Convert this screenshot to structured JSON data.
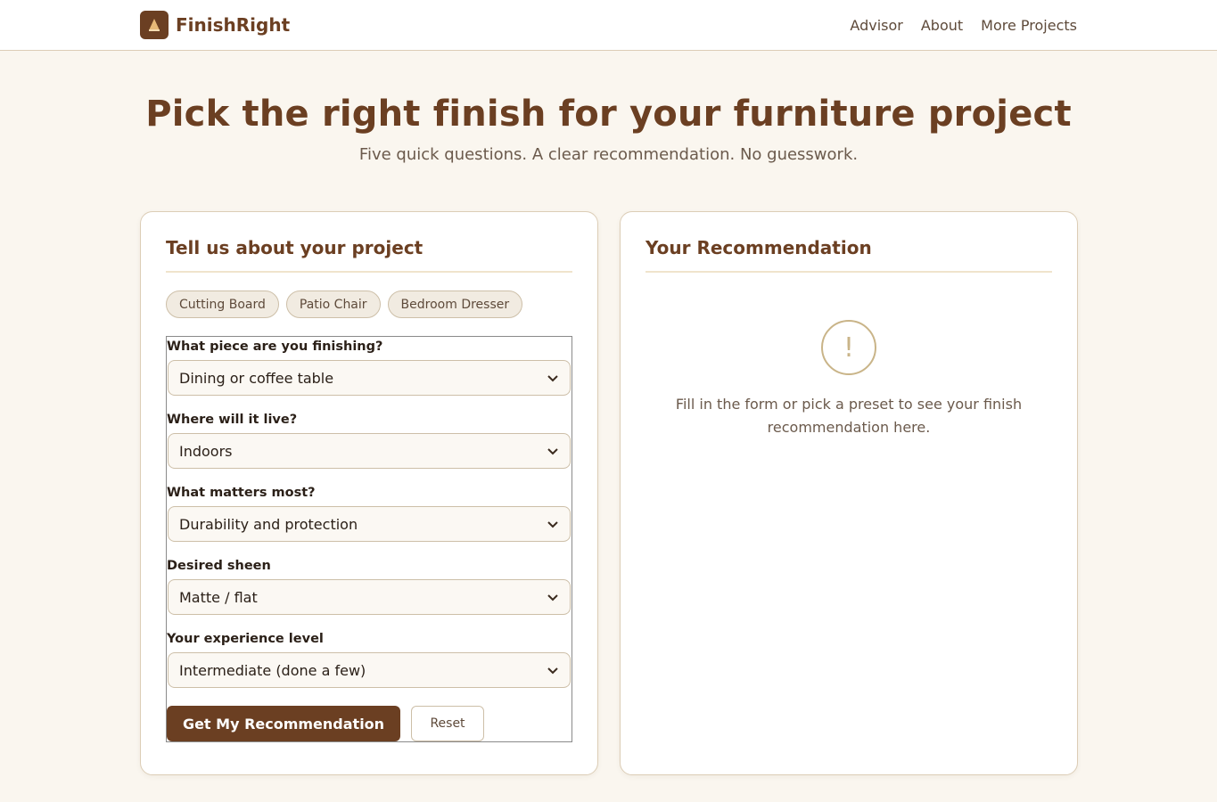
{
  "brand": {
    "name": "FinishRight",
    "logo_icon": "cone-logo-icon"
  },
  "nav": {
    "items": [
      "Advisor",
      "About",
      "More Projects"
    ]
  },
  "hero": {
    "title": "Pick the right finish for your furniture project",
    "subtitle": "Five quick questions. A clear recommendation. No guesswork."
  },
  "form_card": {
    "title": "Tell us about your project",
    "presets": [
      "Cutting Board",
      "Patio Chair",
      "Bedroom Dresser"
    ],
    "fields": [
      {
        "label": "What piece are you finishing?",
        "value": "Dining or coffee table"
      },
      {
        "label": "Where will it live?",
        "value": "Indoors"
      },
      {
        "label": "What matters most?",
        "value": "Durability and protection"
      },
      {
        "label": "Desired sheen",
        "value": "Matte / flat"
      },
      {
        "label": "Your experience level",
        "value": "Intermediate (done a few)"
      }
    ],
    "submit_label": "Get My Recommendation",
    "reset_label": "Reset"
  },
  "result_card": {
    "title": "Your Recommendation",
    "empty_icon": "!",
    "empty_text": "Fill in the form or pick a preset to see your finish recommendation here."
  },
  "colors": {
    "brand": "#6b3f22",
    "background": "#faf6ef",
    "border": "#dccdb6"
  }
}
